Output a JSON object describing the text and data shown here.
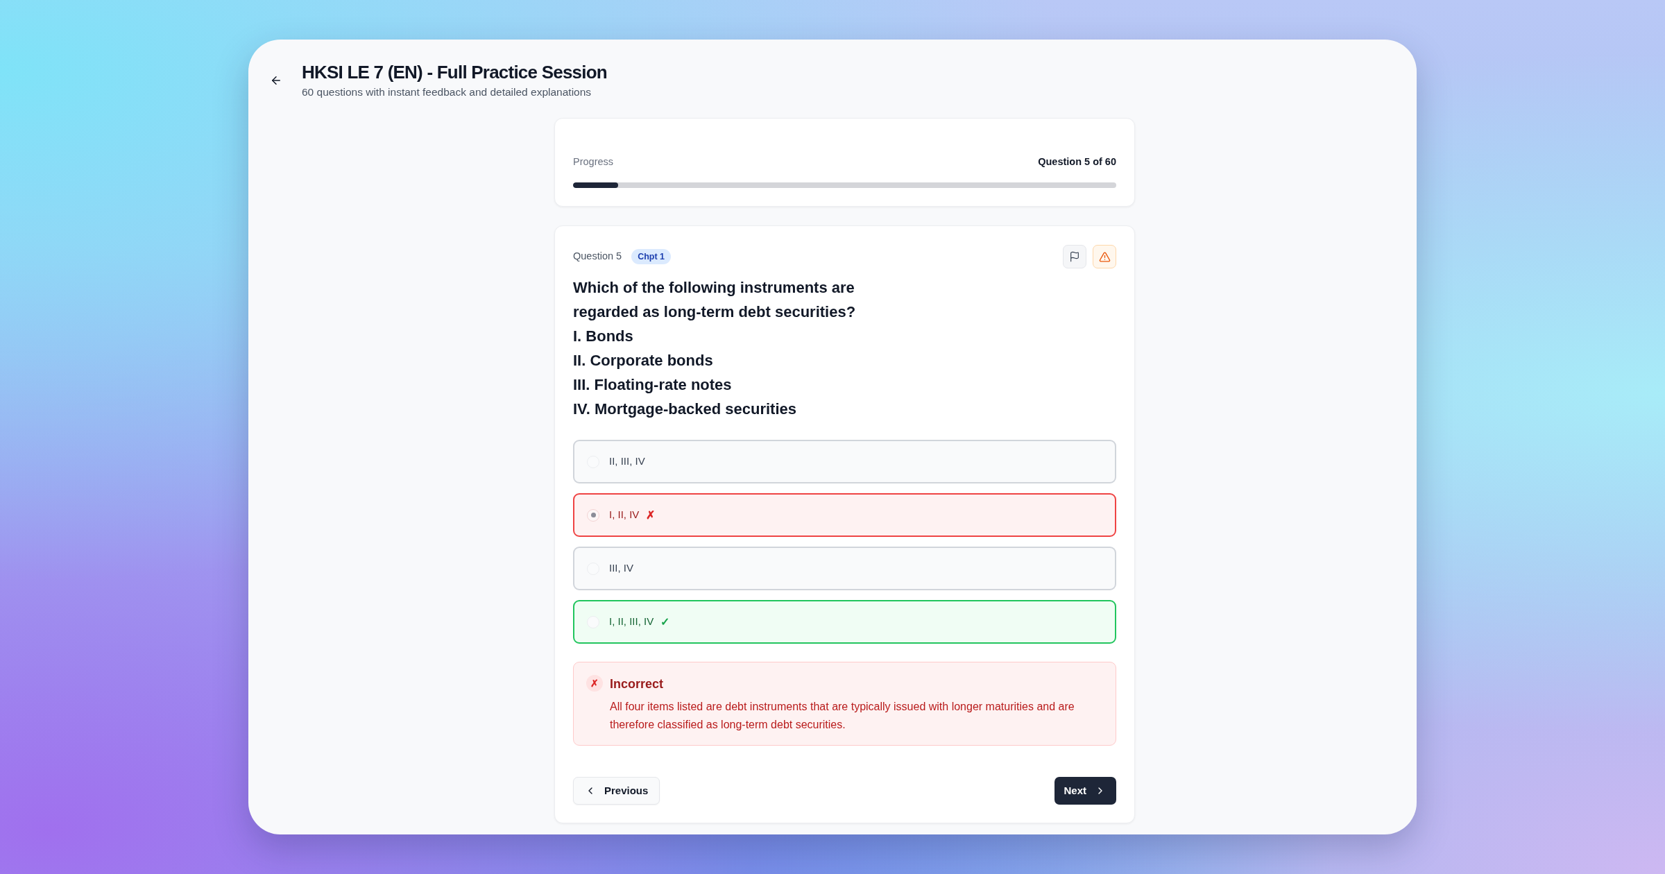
{
  "header": {
    "title": "HKSI LE 7 (EN) - Full Practice Session",
    "subtitle": "60 questions with instant feedback and detailed explanations"
  },
  "progress": {
    "label": "Progress",
    "counter": "Question 5 of 60",
    "level": 0.0833
  },
  "question": {
    "number": "Question 5",
    "chapter": "Chpt 1",
    "text": "Which of the following instruments are regarded as long-term debt securities?",
    "statements": [
      "I. Bonds",
      "II. Corporate bonds",
      "III. Floating-rate notes",
      "IV. Mortgage-backed securities"
    ]
  },
  "options": [
    {
      "label": "II, III, IV",
      "selected": false,
      "kind": "plain"
    },
    {
      "label": "I, II, IV",
      "selected": true,
      "kind": "incorrect",
      "mark": "✗"
    },
    {
      "label": "III, IV",
      "selected": false,
      "kind": "plain"
    },
    {
      "label": "I, II, III, IV",
      "selected": false,
      "kind": "correct",
      "mark": "✓"
    }
  ],
  "feedback": {
    "kind": "incorrect",
    "icon": "✗",
    "title": "Incorrect",
    "explanation": "All four items listed are debt instruments that are typically issued with longer maturities and are therefore classified as long-term debt securities."
  },
  "navigation": {
    "previous": "Previous",
    "next": "Next"
  }
}
